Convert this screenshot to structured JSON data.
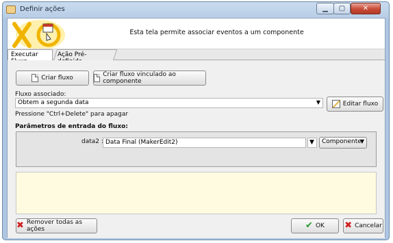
{
  "window": {
    "title": "Definir ações",
    "minimize": "▁",
    "maximize": "▢",
    "close": "✕"
  },
  "header": {
    "description": "Esta tela permite associar eventos a um componente"
  },
  "tabs": [
    {
      "label": "Executar Fluxo"
    },
    {
      "label": "Ação Pré-definida"
    }
  ],
  "actions": {
    "create_flow": "Criar fluxo",
    "create_linked_flow": "Criar fluxo vinculado ao componente"
  },
  "flow": {
    "label": "Fluxo associado:",
    "value": "Obtem a segunda data",
    "hint": "Pressione \"Ctrl+Delete\" para apagar",
    "edit_button": "Editar fluxo"
  },
  "params": {
    "title": "Parâmetros de entrada do fluxo:",
    "param_label": "data2 :",
    "param_value": "Data Final (MakerEdit2)",
    "source_value": "Componente"
  },
  "footer": {
    "remove_all": "Remover todas as ações",
    "ok": "OK",
    "cancel": "Cancelar"
  }
}
